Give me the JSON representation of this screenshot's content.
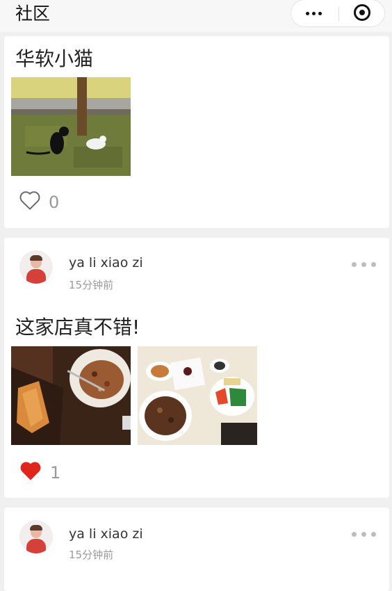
{
  "header": {
    "title": "社区"
  },
  "posts": [
    {
      "text": "华软小猫",
      "likes": "0",
      "liked": false
    },
    {
      "username": "ya li xiao zi",
      "time": "15分钟前",
      "text": "这家店真不错!",
      "likes": "1",
      "liked": true
    },
    {
      "username": "ya li xiao zi",
      "time": "15分钟前"
    }
  ],
  "colors": {
    "like_active": "#e0251c",
    "like_inactive": "#999999"
  }
}
